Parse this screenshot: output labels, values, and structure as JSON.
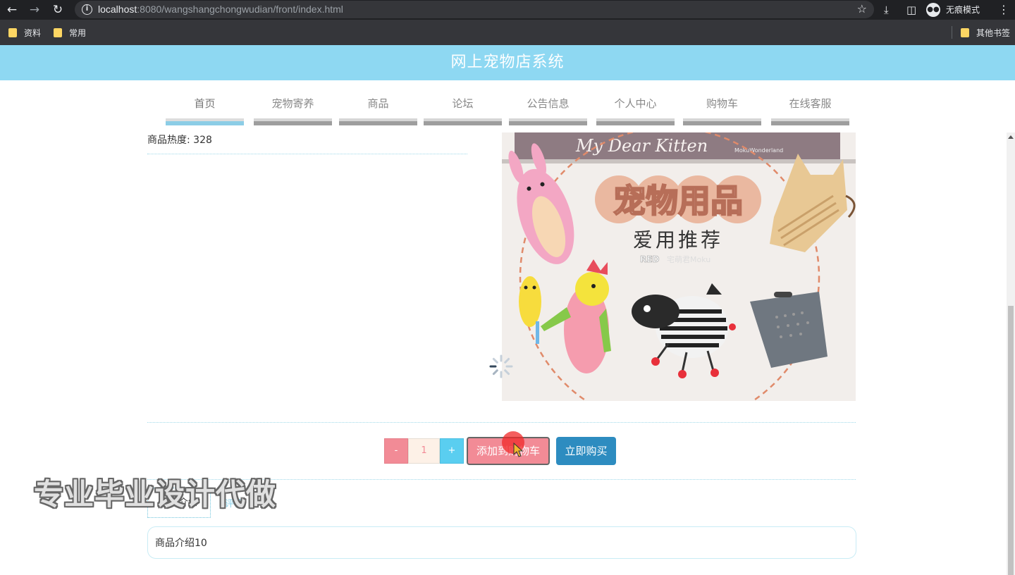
{
  "browser": {
    "url_host": "localhost",
    "url_rest": ":8080/wangshangchongwudian/front/index.html",
    "incognito_label": "无痕模式",
    "bookmarks": [
      "资料",
      "常用"
    ],
    "other_bookmarks": "其他书签"
  },
  "site": {
    "title": "网上宠物店系统"
  },
  "nav": {
    "items": [
      "首页",
      "宠物寄养",
      "商品",
      "论坛",
      "公告信息",
      "个人中心",
      "购物车",
      "在线客服"
    ],
    "active_index": 0
  },
  "product": {
    "hotness": "商品热度: 328",
    "image_text": {
      "banner": "My Dear Kitten",
      "brand": "MokuWonderland",
      "headline": "宠物用品",
      "subline": "爱用推荐",
      "tag": "RED",
      "tag_suffix": "宅萌君Moku"
    }
  },
  "purchase": {
    "minus": "-",
    "quantity": "1",
    "plus": "+",
    "add_to_cart": "添加到购物车",
    "buy_now": "立即购买"
  },
  "tabs": {
    "intro": "商品介绍",
    "comments": "评论"
  },
  "description": "商品介绍10",
  "watermark": "专业毕业设计代做",
  "colors": {
    "header_bg": "#8ed8f2",
    "add_cart_bg": "#f28b96",
    "plus_bg": "#5acef0",
    "buy_bg": "#2d8cc0"
  }
}
